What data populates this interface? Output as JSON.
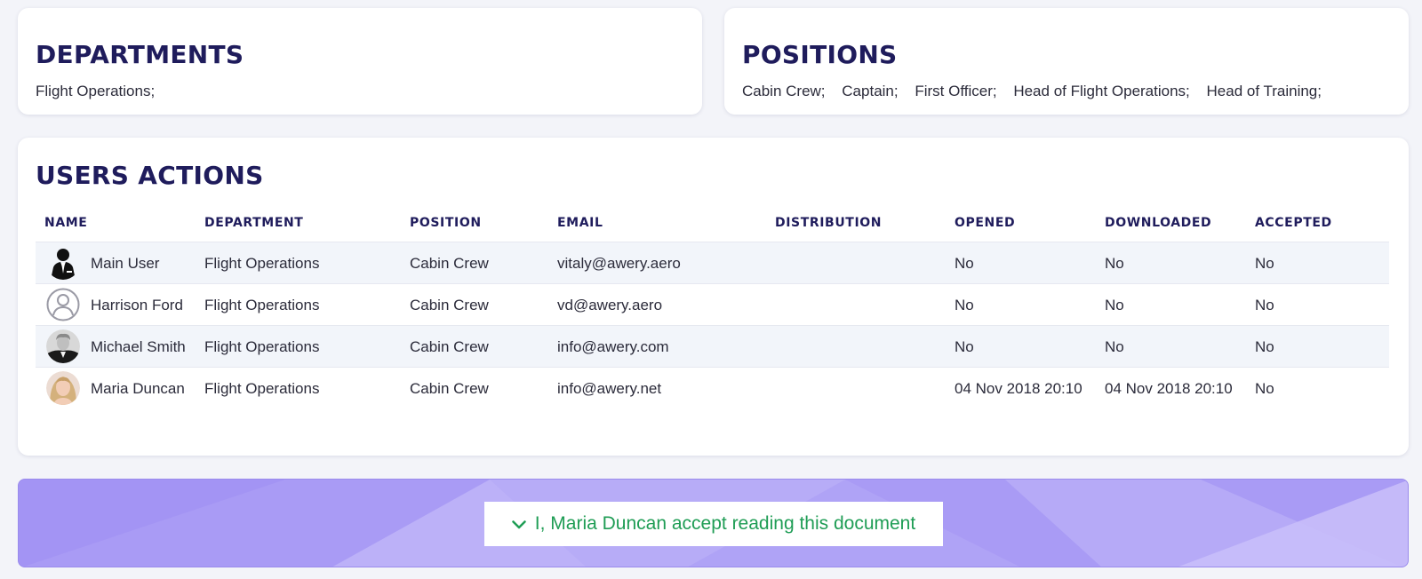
{
  "departments": {
    "title": "DEPARTMENTS",
    "items": [
      "Flight Operations;"
    ]
  },
  "positions": {
    "title": "POSITIONS",
    "items": [
      "Cabin Crew;",
      "Captain;",
      "First Officer;",
      "Head of Flight Operations;",
      "Head of Training;"
    ]
  },
  "users_actions": {
    "title": "USERS ACTIONS",
    "columns": [
      "NAME",
      "DEPARTMENT",
      "POSITION",
      "EMAIL",
      "DISTRIBUTION",
      "OPENED",
      "DOWNLOADED",
      "ACCEPTED"
    ],
    "rows": [
      {
        "avatar": "user-suit-icon",
        "name": "Main User",
        "department": "Flight Operations",
        "position": "Cabin Crew",
        "email": "vitaly@awery.aero",
        "distribution": "",
        "opened": "No",
        "downloaded": "No",
        "accepted": "No"
      },
      {
        "avatar": "user-placeholder-icon",
        "name": "Harrison Ford",
        "department": "Flight Operations",
        "position": "Cabin Crew",
        "email": "vd@awery.aero",
        "distribution": "",
        "opened": "No",
        "downloaded": "No",
        "accepted": "No"
      },
      {
        "avatar": "user-photo-michael",
        "name": "Michael Smith",
        "department": "Flight Operations",
        "position": "Cabin Crew",
        "email": "info@awery.com",
        "distribution": "",
        "opened": "No",
        "downloaded": "No",
        "accepted": "No"
      },
      {
        "avatar": "user-photo-maria",
        "name": "Maria Duncan",
        "department": "Flight Operations",
        "position": "Cabin Crew",
        "email": "info@awery.net",
        "distribution": "",
        "opened": "04 Nov 2018 20:10",
        "downloaded": "04 Nov 2018 20:10",
        "accepted": "No"
      }
    ]
  },
  "accept": {
    "label": "I, Maria Duncan accept reading this document",
    "icon": "check-icon"
  },
  "colors": {
    "title": "#1f1c5c",
    "banner": "#a99bf5",
    "accept_text": "#1f9d55",
    "row_alt": "#f2f5fa"
  }
}
